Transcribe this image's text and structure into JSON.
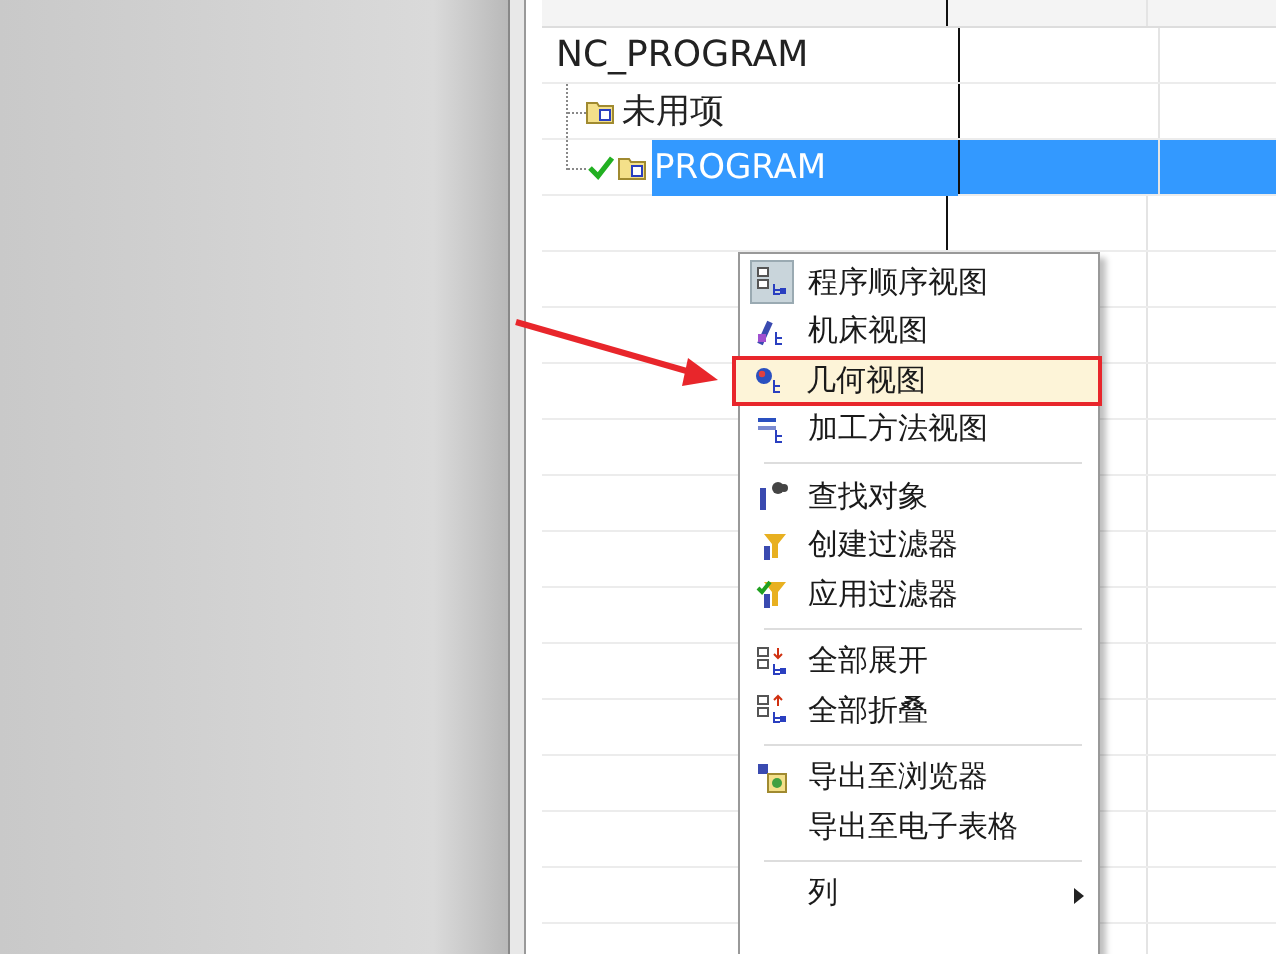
{
  "tree": [
    {
      "label": "NC_PROGRAM",
      "selected": false,
      "checked": false,
      "children": [
        {
          "label": "未用项",
          "selected": false,
          "checked": false
        },
        {
          "label": "PROGRAM",
          "selected": true,
          "checked": true
        }
      ]
    }
  ],
  "context_menu": {
    "groups": [
      [
        {
          "label": "程序顺序视图",
          "checked": true,
          "selected": false
        },
        {
          "label": "机床视图",
          "checked": false,
          "selected": false
        },
        {
          "label": "几何视图",
          "checked": false,
          "selected": true
        },
        {
          "label": "加工方法视图",
          "checked": false,
          "selected": false
        }
      ],
      [
        {
          "label": "查找对象",
          "checked": false,
          "selected": false
        },
        {
          "label": "创建过滤器",
          "checked": false,
          "selected": false
        },
        {
          "label": "应用过滤器",
          "checked": false,
          "selected": false
        }
      ],
      [
        {
          "label": "全部展开",
          "checked": false,
          "selected": false
        },
        {
          "label": "全部折叠",
          "checked": false,
          "selected": false
        }
      ],
      [
        {
          "label": "导出至浏览器",
          "checked": false,
          "selected": false
        },
        {
          "label": "导出至电子表格",
          "checked": false,
          "selected": false
        }
      ],
      [
        {
          "label": "列",
          "checked": false,
          "selected": false,
          "kind": "submenu"
        }
      ]
    ]
  }
}
